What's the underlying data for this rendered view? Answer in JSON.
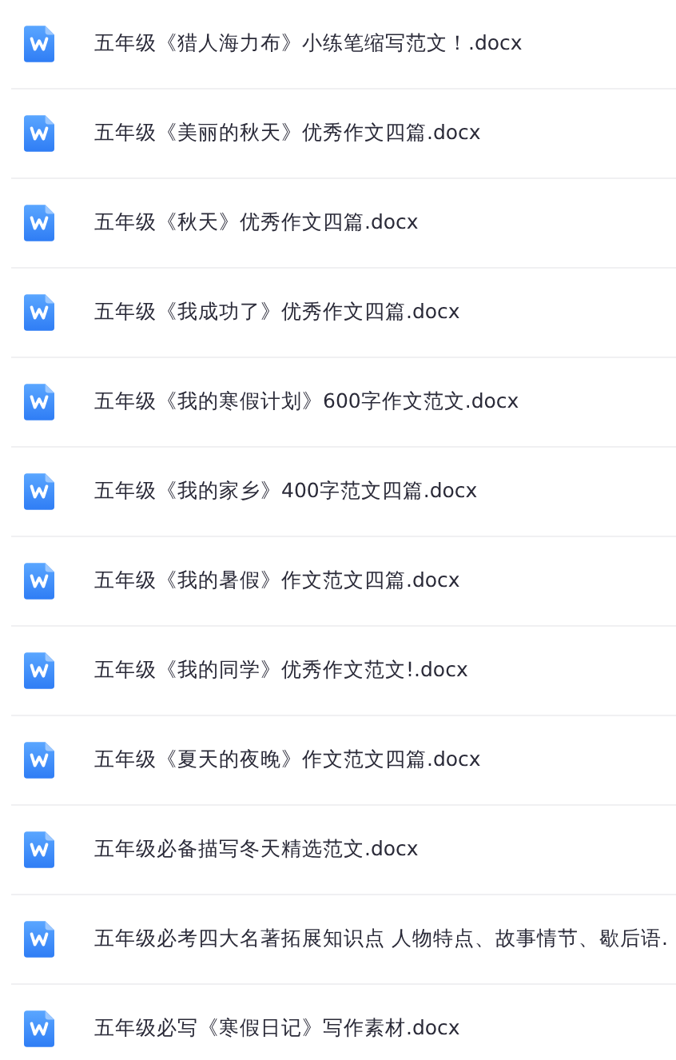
{
  "files": [
    {
      "name": "五年级《猎人海力布》小练笔缩写范文！.docx"
    },
    {
      "name": "五年级《美丽的秋天》优秀作文四篇.docx"
    },
    {
      "name": "五年级《秋天》优秀作文四篇.docx"
    },
    {
      "name": "五年级《我成功了》优秀作文四篇.docx"
    },
    {
      "name": "五年级《我的寒假计划》600字作文范文.docx"
    },
    {
      "name": "五年级《我的家乡》400字范文四篇.docx"
    },
    {
      "name": "五年级《我的暑假》作文范文四篇.docx"
    },
    {
      "name": "五年级《我的同学》优秀作文范文!.docx"
    },
    {
      "name": "五年级《夏天的夜晚》作文范文四篇.docx"
    },
    {
      "name": "五年级必备描写冬天精选范文.docx"
    },
    {
      "name": "五年级必考四大名著拓展知识点 人物特点、故事情节、歇后语."
    },
    {
      "name": "五年级必写《寒假日记》写作素材.docx"
    }
  ]
}
